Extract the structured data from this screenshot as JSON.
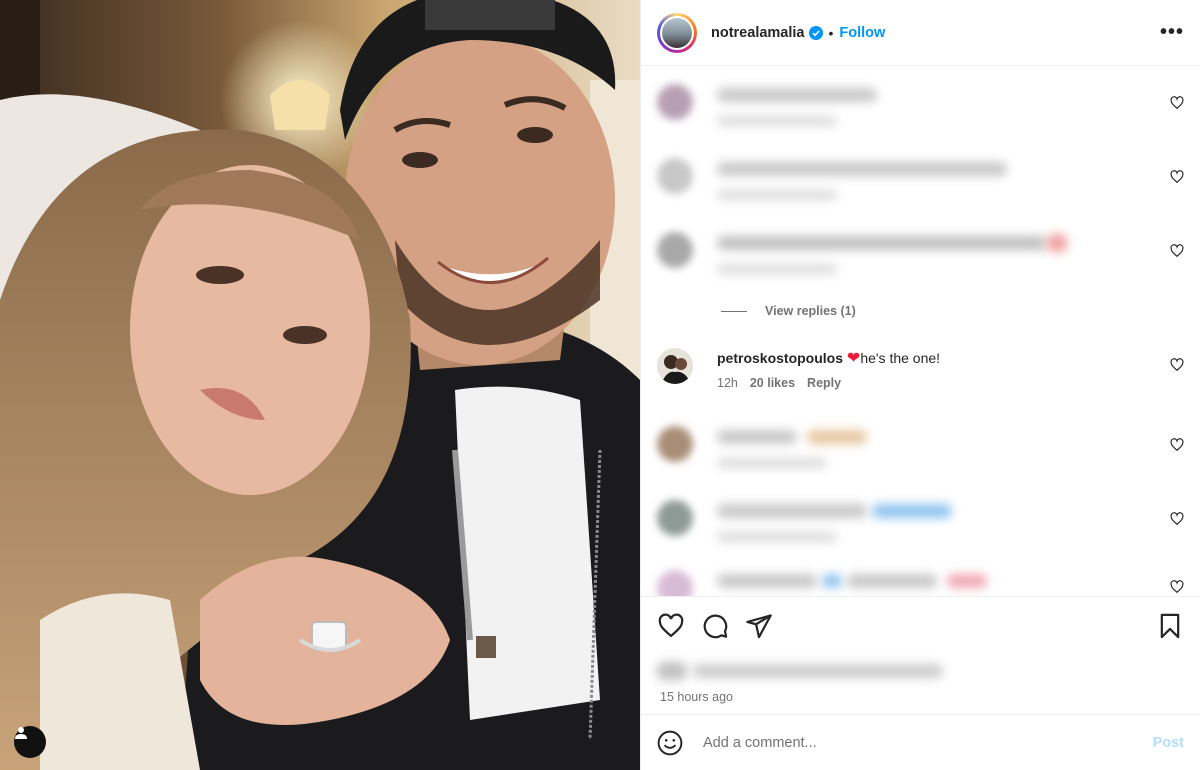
{
  "post": {
    "username": "notrealamalia",
    "follow_label": "Follow",
    "separator": "•",
    "more_label": "•••",
    "timestamp": "15 hours ago"
  },
  "comments": {
    "view_replies": "View replies (1)",
    "featured": {
      "username": "petroskostopoulos",
      "text": "he's the one!",
      "time": "12h",
      "likes": "20 likes",
      "reply_label": "Reply"
    }
  },
  "composer": {
    "placeholder": "Add a comment...",
    "post_label": "Post"
  },
  "colors": {
    "accent": "#0095f6",
    "post_disabled": "#b2dffc",
    "heart": "#ed1c3a"
  },
  "icons": [
    "verified-badge-icon",
    "more-options-icon",
    "heart-icon",
    "comment-icon",
    "share-icon",
    "bookmark-icon",
    "emoji-icon",
    "user-tag-icon"
  ]
}
